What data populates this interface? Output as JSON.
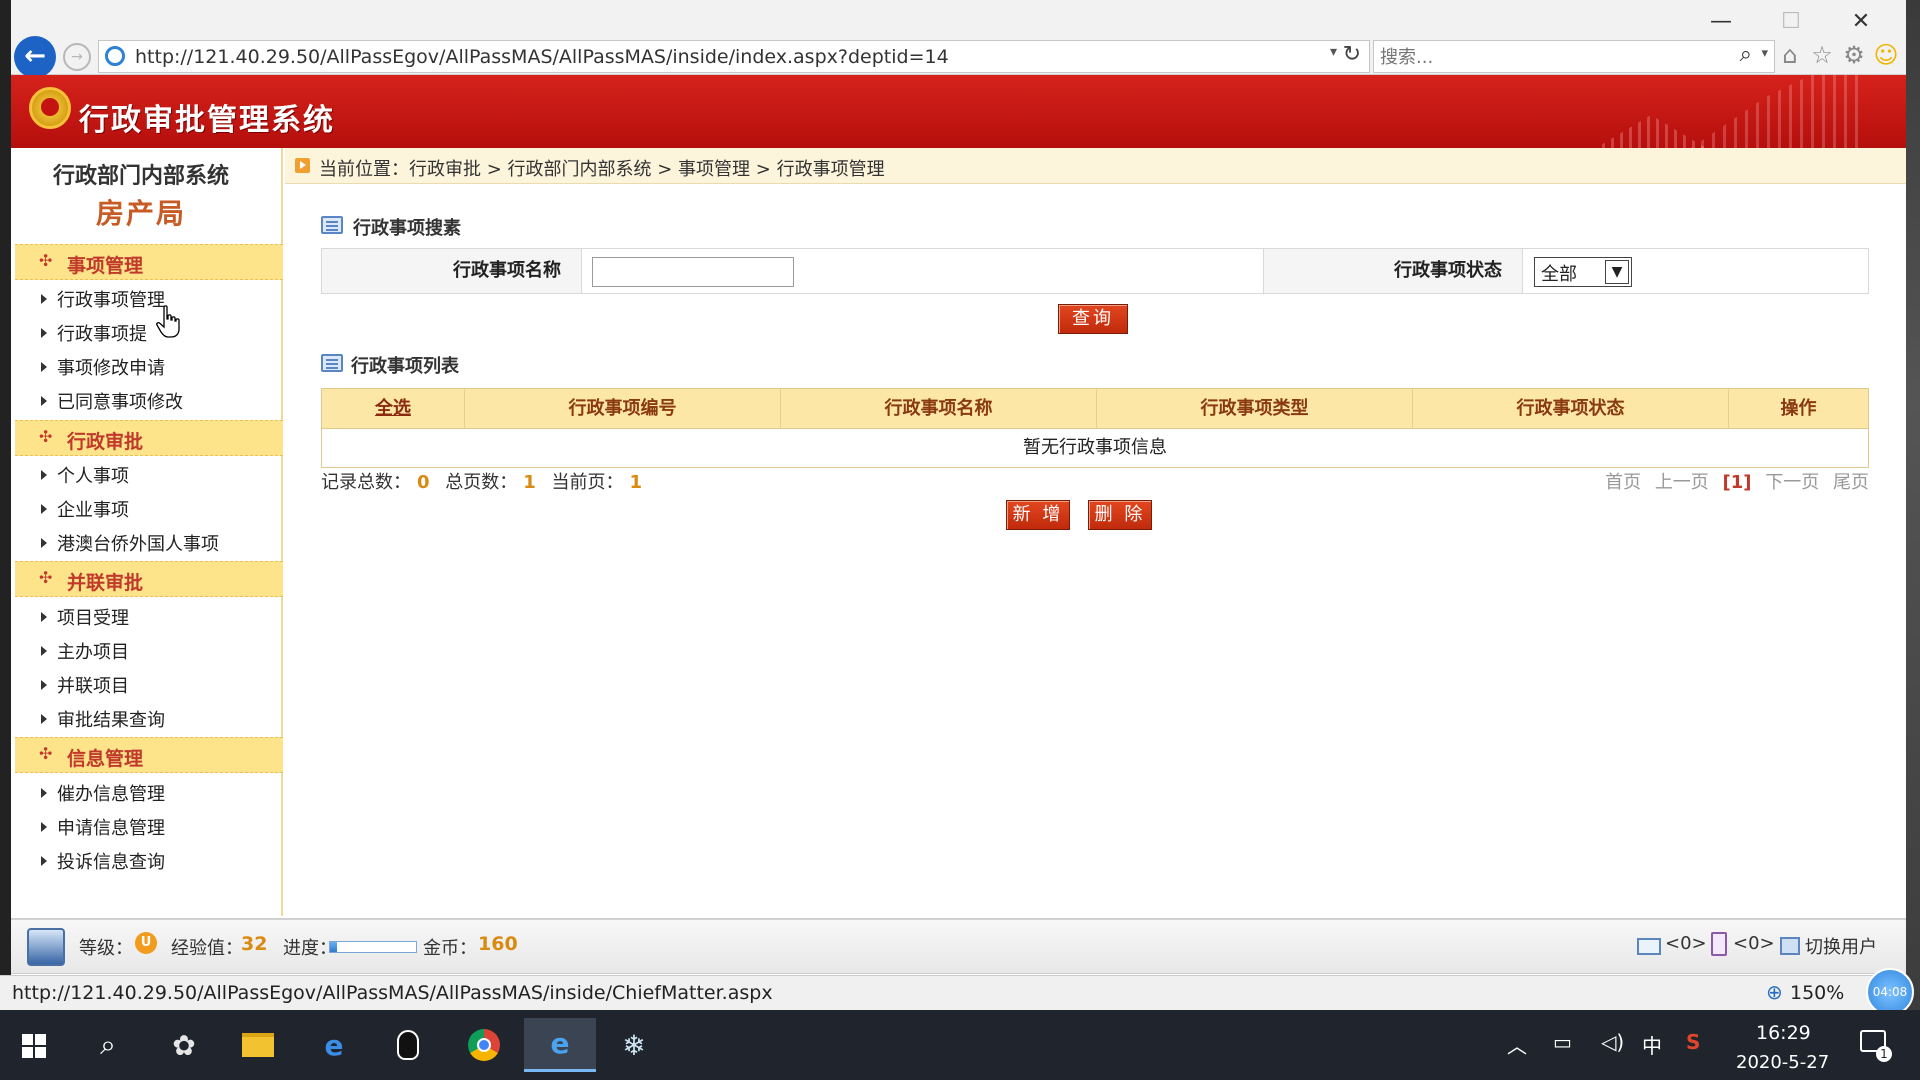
{
  "browser": {
    "url": "http://121.40.29.50/AllPassEgov/AllPassMAS/AllPassMAS/inside/index.aspx?deptid=14",
    "search_placeholder": "搜索...",
    "status_url": "http://121.40.29.50/AllPassEgov/AllPassMAS/AllPassMAS/inside/ChiefMatter.aspx",
    "zoom": "150%",
    "timer": "04:08"
  },
  "header": {
    "title": "行政审批管理系统"
  },
  "sidebar": {
    "dept": "行政部门内部系统",
    "bureau": "房产局",
    "groups": [
      {
        "label": "事项管理",
        "items": [
          "行政事项管理",
          "行政事项提",
          "事项修改申请",
          "已同意事项修改"
        ]
      },
      {
        "label": "行政审批",
        "items": [
          "个人事项",
          "企业事项",
          "港澳台侨外国人事项"
        ]
      },
      {
        "label": "并联审批",
        "items": [
          "项目受理",
          "主办项目",
          "并联项目",
          "审批结果查询"
        ]
      },
      {
        "label": "信息管理",
        "items": [
          "催办信息管理",
          "申请信息管理",
          "投诉信息查询"
        ]
      }
    ]
  },
  "main": {
    "breadcrumb": "当前位置：行政审批 > 行政部门内部系统 > 事项管理 > 行政事项管理",
    "search_section_title": "行政事项搜素",
    "name_label": "行政事项名称",
    "name_value": "",
    "status_label": "行政事项状态",
    "status_selected": "全部",
    "query_button": "查询",
    "list_section_title": "行政事项列表",
    "columns": [
      "全选",
      "行政事项编号",
      "行政事项名称",
      "行政事项类型",
      "行政事项状态",
      "操作"
    ],
    "empty_message": "暂无行政事项信息",
    "pager": {
      "total_label": "记录总数：",
      "total": "0",
      "pages_label": "总页数：",
      "pages": "1",
      "current_label": "当前页：",
      "current": "1",
      "first": "首页",
      "prev": "上一页",
      "current_link": "[1]",
      "next": "下一页",
      "last": "尾页"
    },
    "add_button": "新 增",
    "delete_button": "删 除"
  },
  "user_bar": {
    "level_label": "等级：",
    "level_badge": "U",
    "exp_label": "经验值：",
    "exp_value": "32",
    "progress_label": "进度：",
    "progress_fraction": 0.08,
    "coin_label": "金币：",
    "coin_value": "160",
    "mail_count": "<0>",
    "sms_count": "<0>",
    "switch_user": "切换用户"
  },
  "taskbar": {
    "ime": "中",
    "time": "16:29",
    "date": "2020-5-27",
    "notifications": "1"
  },
  "colors": {
    "header_red": "#c4140f",
    "accent_orange": "#d98a10",
    "nav_group_bg": "#fde48a",
    "button_red": "#c02b0c"
  }
}
